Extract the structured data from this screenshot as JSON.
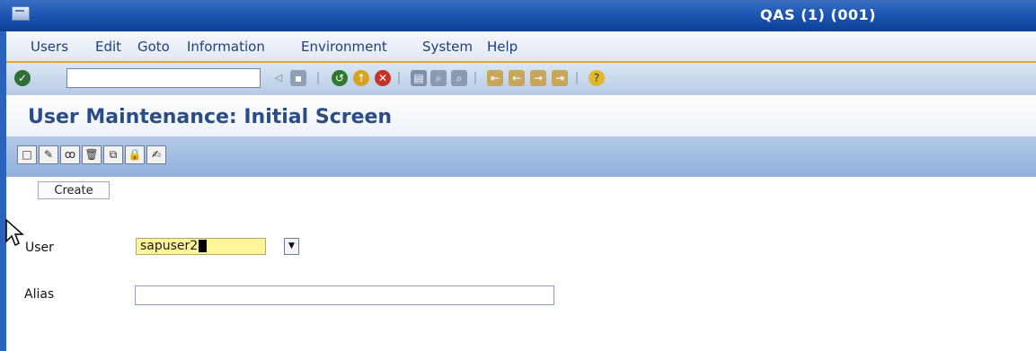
{
  "window": {
    "title": "QAS (1) (001)"
  },
  "menubar": {
    "items": [
      {
        "label": "Users"
      },
      {
        "label": "Edit"
      },
      {
        "label": "Goto"
      },
      {
        "label": "Information"
      },
      {
        "label": "Environment"
      },
      {
        "label": "System"
      },
      {
        "label": "Help"
      }
    ]
  },
  "toolbar": {
    "command_field": {
      "value": ""
    },
    "icons": [
      "enter-icon",
      "back-arrow-icon",
      "save-icon",
      "back-icon",
      "exit-icon",
      "cancel-icon",
      "print-icon",
      "find-icon",
      "find-next-icon",
      "first-page-icon",
      "previous-page-icon",
      "next-page-icon",
      "last-page-icon",
      "help-icon"
    ]
  },
  "screen": {
    "title": "User Maintenance: Initial Screen"
  },
  "app_toolbar": {
    "icons": [
      "create-icon",
      "change-icon",
      "display-icon",
      "delete-icon",
      "copy-icon",
      "lock-icon",
      "change-password-icon"
    ]
  },
  "tooltip": {
    "create": "Create"
  },
  "form": {
    "user": {
      "label": "User",
      "value": "sapuser2"
    },
    "alias": {
      "label": "Alias",
      "value": ""
    }
  },
  "colors": {
    "title_bar": "#1d57b3",
    "menu_text": "#1f3f7d",
    "accent_border": "#f0a020",
    "screen_title": "#2b4d85",
    "required_field": "#fff59a"
  }
}
